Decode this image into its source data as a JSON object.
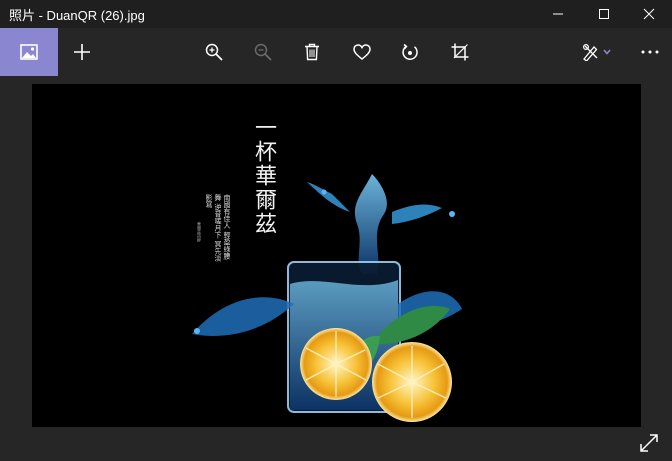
{
  "window": {
    "title": "照片 - DuanQR (26).jpg",
    "minimize_icon": "minimize-icon",
    "maximize_icon": "maximize-icon",
    "close_icon": "close-icon"
  },
  "toolbar": {
    "left": [
      {
        "name": "see-all-photos-button",
        "icon": "image-icon"
      },
      {
        "name": "add-button",
        "icon": "plus-icon"
      }
    ],
    "center": [
      {
        "name": "zoom-in-button",
        "icon": "zoom-in-icon"
      },
      {
        "name": "zoom-out-button",
        "icon": "zoom-out-icon",
        "disabled": true
      },
      {
        "name": "delete-button",
        "icon": "trash-icon"
      },
      {
        "name": "favorite-button",
        "icon": "heart-icon"
      },
      {
        "name": "rotate-button",
        "icon": "rotate-icon"
      },
      {
        "name": "crop-button",
        "icon": "crop-icon"
      }
    ],
    "right": [
      {
        "name": "edit-create-button",
        "icon": "edit-draw-icon"
      },
      {
        "name": "see-more-button",
        "icon": "more-icon"
      }
    ],
    "accent_color": "#8a86d0"
  },
  "photo": {
    "poem_title": "一杯華爾茲",
    "poem_lines": "南國有佳人 輕盈綠腰舞 逆昔嗟月下 冥先淡影寫",
    "signature": "華爾茲詩醉"
  },
  "viewer": {
    "expand_icon": "expand-fullscreen-icon"
  }
}
